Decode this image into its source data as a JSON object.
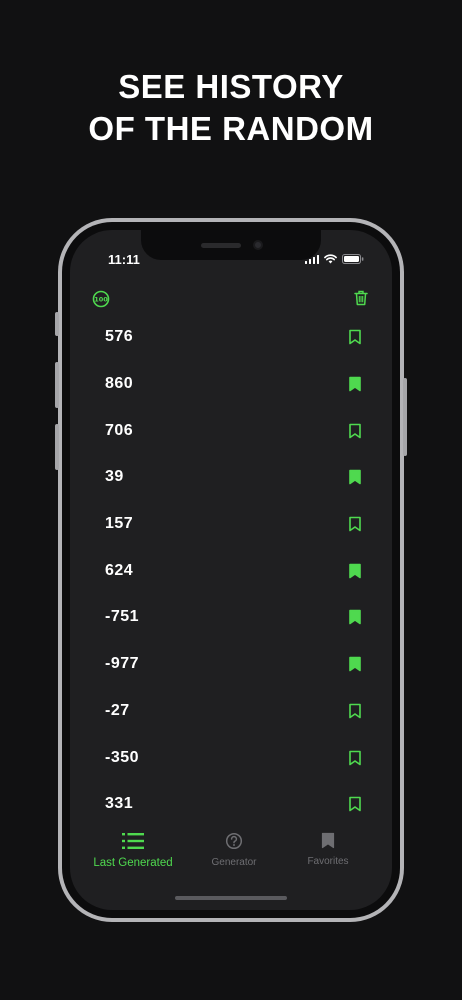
{
  "headline": {
    "line1": "SEE HISTORY",
    "line2": "OF THE RANDOM"
  },
  "status_bar": {
    "time": "11:11"
  },
  "top_bar": {
    "counter_icon_label": "100"
  },
  "history": [
    {
      "value": "576",
      "bookmarked": false
    },
    {
      "value": "860",
      "bookmarked": true
    },
    {
      "value": "706",
      "bookmarked": false
    },
    {
      "value": "39",
      "bookmarked": true
    },
    {
      "value": "157",
      "bookmarked": false
    },
    {
      "value": "624",
      "bookmarked": true
    },
    {
      "value": "-751",
      "bookmarked": true
    },
    {
      "value": "-977",
      "bookmarked": true
    },
    {
      "value": "-27",
      "bookmarked": false
    },
    {
      "value": "-350",
      "bookmarked": false
    },
    {
      "value": "331",
      "bookmarked": false
    }
  ],
  "tabs": [
    {
      "label": "Last Generated",
      "icon": "list-icon",
      "active": true
    },
    {
      "label": "Generator",
      "icon": "question-circle-icon",
      "active": false
    },
    {
      "label": "Favorites",
      "icon": "bookmark-icon",
      "active": false
    }
  ],
  "colors": {
    "accent": "#4fd94f",
    "background": "#111112",
    "screen": "#1f1f21",
    "inactive": "#6e6e72"
  }
}
